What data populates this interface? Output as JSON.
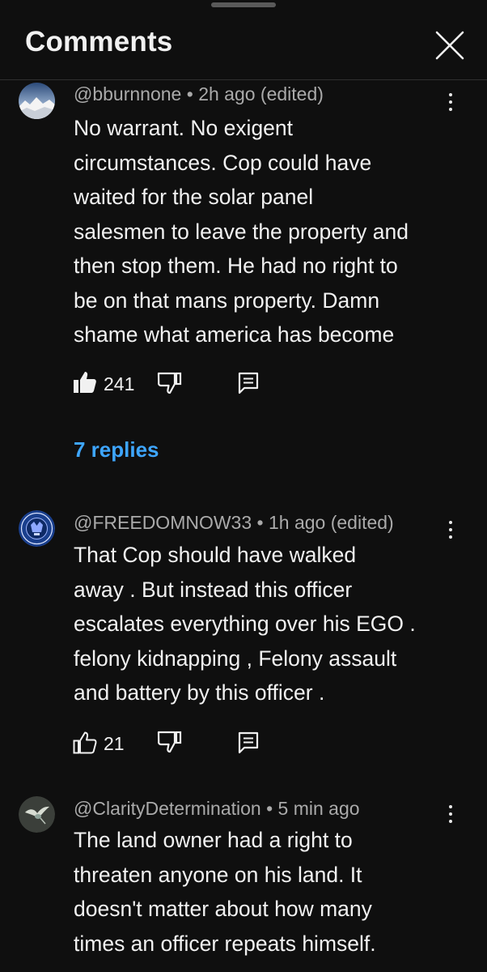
{
  "header": {
    "title": "Comments"
  },
  "comments": [
    {
      "author": "@bburnnone",
      "time": "2h ago (edited)",
      "text": "No warrant. No exigent\ncircumstances. Cop could have\nwaited for the solar panel\nsalesmen to leave the property and\nthen stop them. He had no right to\nbe on that mans property. Damn\nshame what america has become",
      "likes": "241",
      "liked": true,
      "replies_label": "7 replies"
    },
    {
      "author": "@FREEDOMNOW33",
      "time": "1h ago (edited)",
      "text": "That Cop should have walked\naway . But instead this officer\nescalates everything over his EGO .\nfelony kidnapping , Felony assault\nand battery by this officer .",
      "likes": "21",
      "liked": false
    },
    {
      "author": "@ClarityDetermination",
      "time": "5 min ago",
      "text": "The land owner had a right to\nthreaten anyone on his land. It\ndoesn't matter about how many\ntimes an officer repeats himself."
    }
  ],
  "separator": " • ",
  "icons": {
    "close": "close-icon",
    "more": "more-vert-icon",
    "like": "thumb-up-icon",
    "dislike": "thumb-down-icon",
    "reply": "reply-comment-icon"
  },
  "colors": {
    "background": "#0f0f0f",
    "text": "#f1f1f1",
    "meta": "#aaaaaa",
    "link": "#3ea6ff"
  }
}
